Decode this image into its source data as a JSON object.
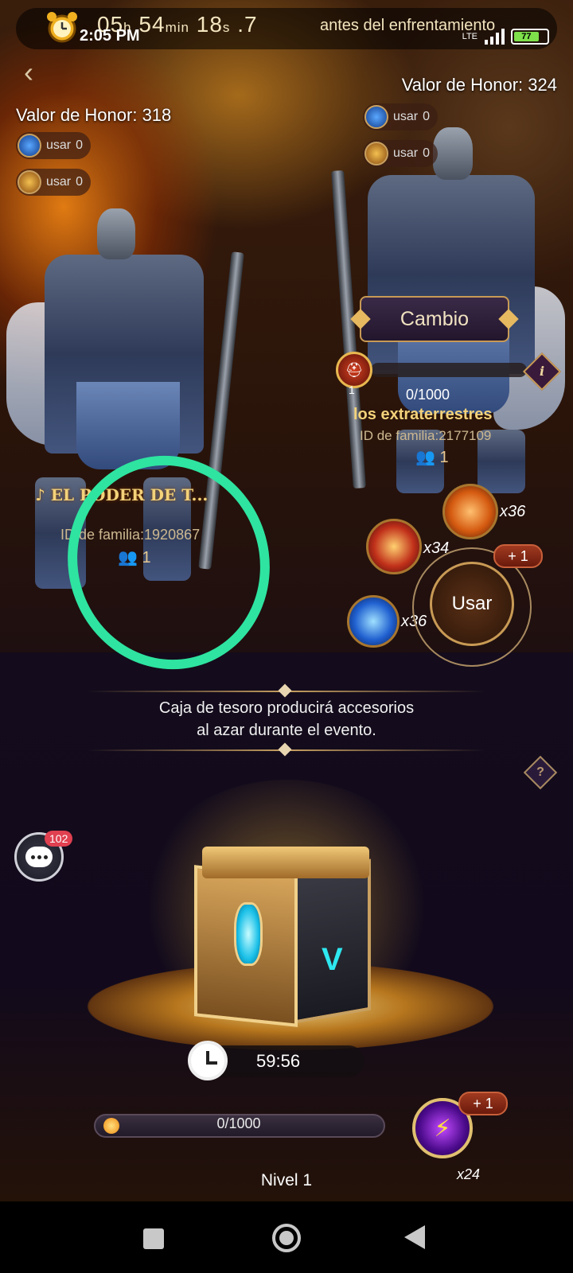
{
  "status_bar": {
    "time": "2:05 PM",
    "countdown_hours": "05",
    "countdown_hours_unit": "h",
    "countdown_minutes": "54",
    "countdown_minutes_unit": "min",
    "countdown_seconds": "18",
    "countdown_seconds_unit": "s",
    "countdown_tenths": ".7",
    "countdown_label": "antes del enfrentamiento",
    "battery": "77",
    "network": "LTE"
  },
  "left_player": {
    "honor": "Valor de Honor: 318",
    "use_items": [
      {
        "icon": "blue-orb-icon",
        "label": "usar",
        "count": "0"
      },
      {
        "icon": "gold-helmet-icon",
        "label": "usar",
        "count": "0"
      }
    ],
    "family_name": "EL PODER DE T...",
    "family_id": "ID de familia:1920867",
    "members": "1"
  },
  "right_player": {
    "honor": "Valor de Honor: 324",
    "use_items": [
      {
        "icon": "blue-orb-icon",
        "label": "usar",
        "count": "0"
      },
      {
        "icon": "gold-helmet-icon",
        "label": "usar",
        "count": "0"
      }
    ],
    "change_button": "Cambio",
    "badge_level": "1",
    "progress": "0/1000",
    "family_name": "los extraterrestres",
    "family_id": "ID de familia:2177109",
    "members": "1"
  },
  "items": {
    "shield_count": "x36",
    "helmet_count": "x34",
    "orb_count": "x36",
    "use_button": "Usar",
    "use_plus": "+ 1"
  },
  "chest_section": {
    "description_line1": "Caja de tesoro producirá accesorios",
    "description_line2": "al azar durante el evento.",
    "help": "?",
    "timer": "59:56",
    "level_progress": "0/1000",
    "level_progress_fraction": 0,
    "level_label": "Nivel 1",
    "energy_count": "x24",
    "energy_plus": "+ 1"
  },
  "chat": {
    "unread": "102"
  },
  "colors": {
    "accent_gold": "#f3d27a",
    "annotation_circle": "#2ee4a0"
  }
}
